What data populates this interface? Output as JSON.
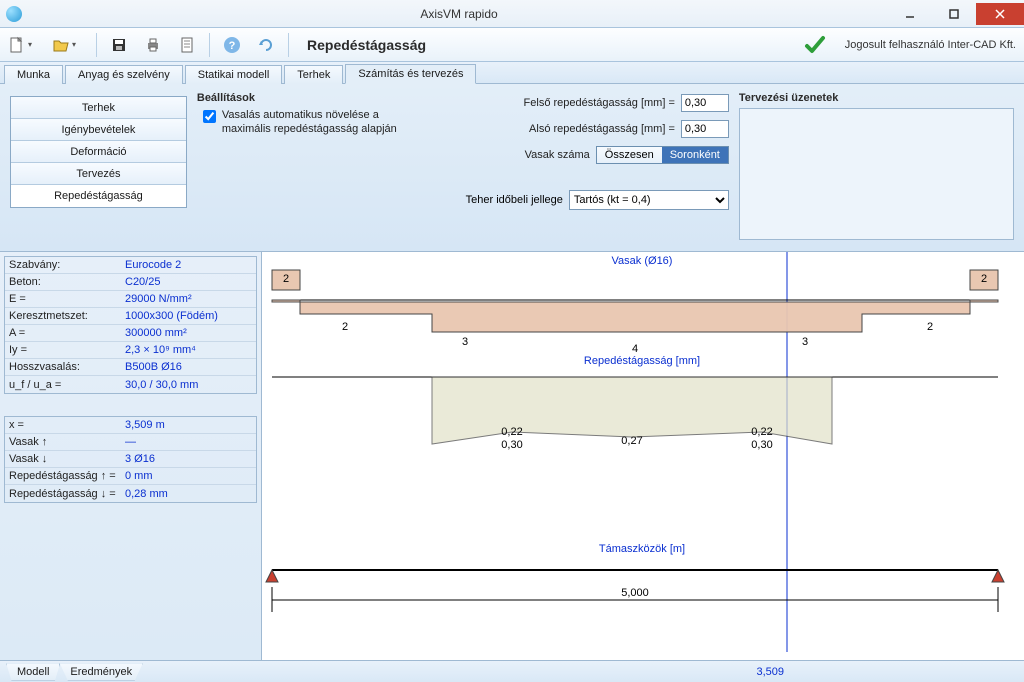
{
  "window": {
    "title": "AxisVM rapido"
  },
  "toolbar": {
    "page_title": "Repedéstágasság",
    "license": "Jogosult felhasználó  Inter-CAD Kft."
  },
  "main_tabs": [
    "Munka",
    "Anyag és szelvény",
    "Statikai modell",
    "Terhek",
    "Számítás és tervezés"
  ],
  "main_tab_active": 4,
  "sub_tabs": [
    "Terhek",
    "Igénybevételek",
    "Deformáció",
    "Tervezés",
    "Repedéstágasság"
  ],
  "sub_tab_active": 4,
  "settings": {
    "title": "Beállítások",
    "chk_label": "Vasalás automatikus növelése a maximális repedéstágasság alapján",
    "chk_checked": true,
    "top_crack_label": "Felső repedéstágasság [mm] =",
    "top_crack_val": "0,30",
    "bot_crack_label": "Alsó repedéstágasság [mm] =",
    "bot_crack_val": "0,30",
    "bars_label": "Vasak száma",
    "bars_opt1": "Összesen",
    "bars_opt2": "Soronként",
    "bars_sel": 1,
    "load_label": "Teher időbeli jellege",
    "load_opt": "Tartós (kt = 0,4)"
  },
  "messages": {
    "title": "Tervezési üzenetek"
  },
  "props": [
    {
      "k": "Szabvány:",
      "v": "Eurocode 2"
    },
    {
      "k": "Beton:",
      "v": "C20/25"
    },
    {
      "k": "E =",
      "v": "29000 N/mm²"
    },
    {
      "k": "Keresztmetszet:",
      "v": "1000x300 (Födém)"
    },
    {
      "k": "A =",
      "v": "300000 mm²"
    },
    {
      "k": "Iy =",
      "v": "2,3 × 10⁹  mm⁴"
    },
    {
      "k": "Hosszvasalás:",
      "v": "B500B Ø16"
    },
    {
      "k": "u_f / u_a =",
      "v": "30,0 / 30,0 mm"
    }
  ],
  "readout": [
    {
      "k": "x =",
      "v": "3,509 m"
    },
    {
      "k": "Vasak ↑",
      "v": "—"
    },
    {
      "k": "Vasak ↓",
      "v": "3 Ø16"
    },
    {
      "k": "Repedéstágasság ↑ =",
      "v": "0 mm"
    },
    {
      "k": "Repedéstágasság ↓ =",
      "v": "0,28 mm"
    }
  ],
  "bottom_tabs": [
    "Modell",
    "Eredmények"
  ],
  "bottom_x": "3,509",
  "chart_data": [
    {
      "type": "bar",
      "title": "Vasak (Ø16)",
      "top_bars": [
        2,
        2
      ],
      "bottom_bars": [
        2,
        3,
        4,
        3,
        2
      ],
      "span": 5.0
    },
    {
      "type": "line",
      "title": "Repedéstágasság [mm]",
      "x": [
        0.0,
        1.0,
        2.5,
        4.0,
        5.0
      ],
      "calc": [
        0.0,
        0.22,
        0.27,
        0.22,
        0.0
      ],
      "limit": [
        0.3,
        0.3,
        0.3,
        0.3,
        0.3
      ],
      "cursor_x": 3.509
    },
    {
      "type": "bar",
      "title": "Támaszközök [m]",
      "categories": [
        "span1"
      ],
      "values": [
        5.0
      ]
    }
  ]
}
